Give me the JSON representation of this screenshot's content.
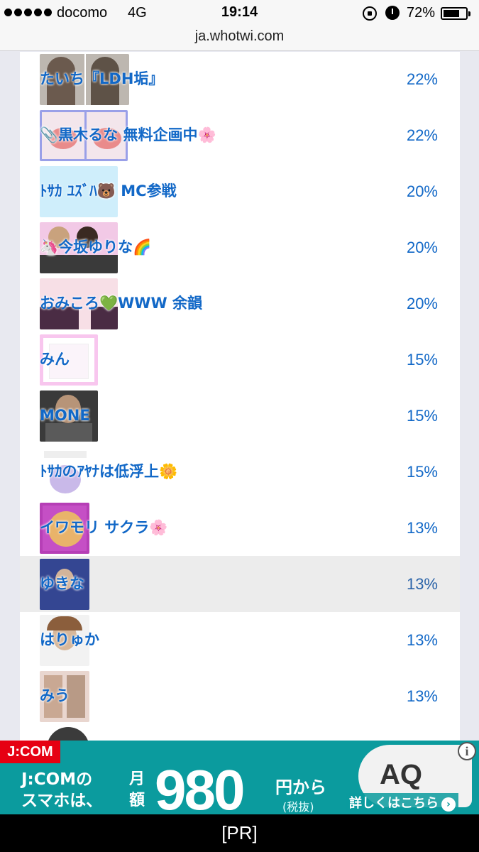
{
  "status_bar": {
    "carrier": "docomo",
    "network": "4G",
    "time": "19:14",
    "battery_percent": "72%",
    "battery_level": 0.72
  },
  "url_bar": {
    "host": "ja.whotwi.com"
  },
  "list": [
    {
      "name": "たいち『LDH垢』",
      "percent": "22%"
    },
    {
      "name": "📎黒木るな 無料企画中🌸",
      "percent": "22%"
    },
    {
      "name": "ﾄｻｶ ﾕｽﾞﾊ🐻 MC参戦",
      "percent": "20%"
    },
    {
      "name": "🦄今坂ゆりな🌈",
      "percent": "20%"
    },
    {
      "name": "おみころ💚WWW 余韻",
      "percent": "20%"
    },
    {
      "name": "みん",
      "percent": "15%"
    },
    {
      "name": "MONE",
      "percent": "15%"
    },
    {
      "name": "ﾄｻｶのｱﾔﾅは低浮上🌼",
      "percent": "15%"
    },
    {
      "name": "イワモリ サクラ🌸",
      "percent": "13%"
    },
    {
      "name": "ゆきな",
      "percent": "13%"
    },
    {
      "name": "はりゅか",
      "percent": "13%"
    },
    {
      "name": "みう",
      "percent": "13%"
    }
  ],
  "ad": {
    "brand": "J:COM",
    "line1": "J:COMの",
    "line2": "スマホは、",
    "monthly": "月額",
    "price": "980",
    "yen_from": "円から",
    "tax_note": "(税抜)",
    "cta": "詳しくはこちら",
    "photo_text": "AQ"
  },
  "pr_label": "[PR]",
  "colors": {
    "link": "#1268c7",
    "ad_bg": "#0b9b9e",
    "ad_logo": "#e60012"
  }
}
